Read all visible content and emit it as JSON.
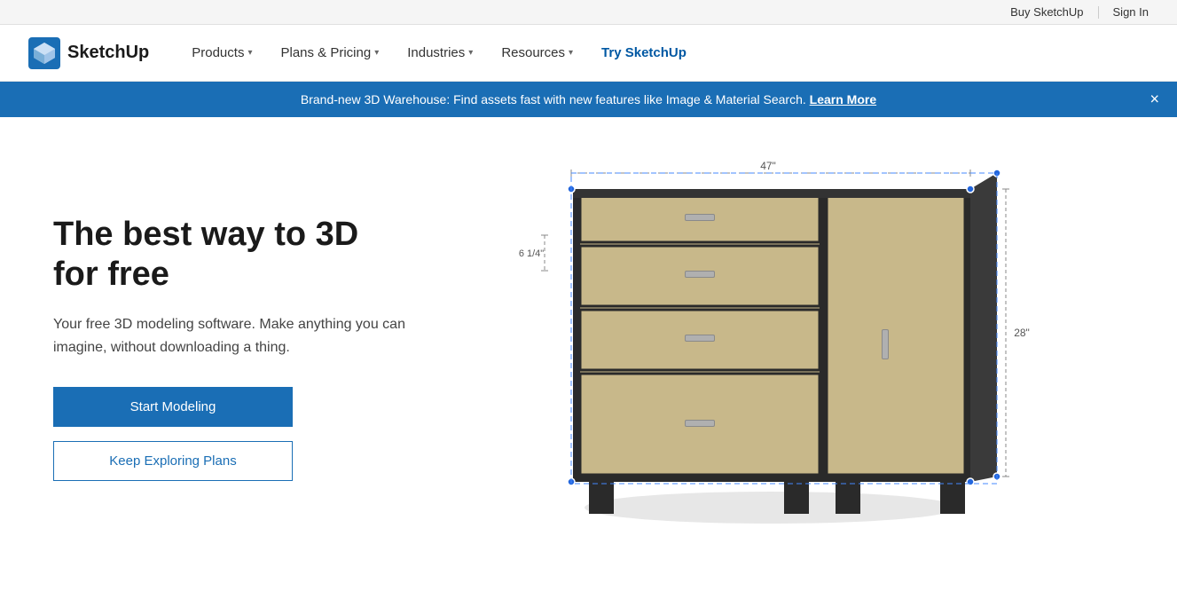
{
  "topbar": {
    "buy_label": "Buy SketchUp",
    "sign_in_label": "Sign In"
  },
  "nav": {
    "logo_alt": "SketchUp",
    "logo_text": "SketchUp",
    "items": [
      {
        "label": "Products",
        "has_chevron": true
      },
      {
        "label": "Plans & Pricing",
        "has_chevron": true
      },
      {
        "label": "Industries",
        "has_chevron": true
      },
      {
        "label": "Resources",
        "has_chevron": true
      },
      {
        "label": "Try SketchUp",
        "has_chevron": false,
        "highlight": true
      }
    ]
  },
  "banner": {
    "text": "Brand-new 3D Warehouse: Find assets fast with new features like Image & Material Search. ",
    "link_text": "Learn More"
  },
  "hero": {
    "title": "The best way to 3D for free",
    "subtitle": "Your free 3D modeling software. Make anything you\ncan imagine, without downloading a thing.",
    "cta_primary": "Start Modeling",
    "cta_secondary": "Keep Exploring Plans"
  },
  "dimensions": {
    "width": "47\"",
    "height_small": "6 1/4\"",
    "height_large": "28\""
  }
}
